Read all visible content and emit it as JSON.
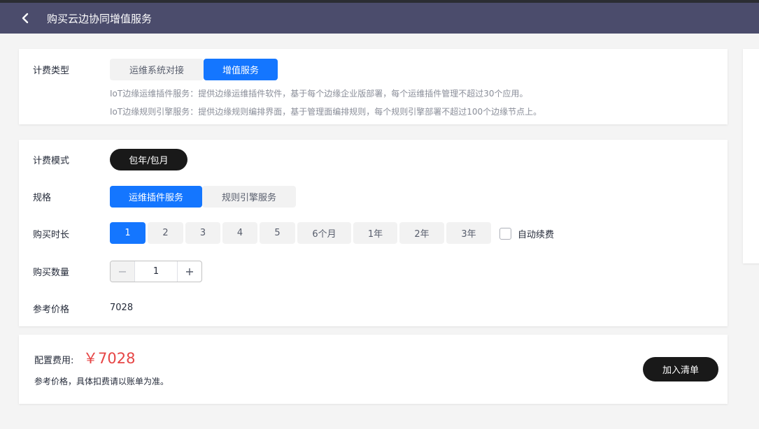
{
  "header": {
    "title": "购买云边协同增值服务",
    "back_icon": "chevron-left-icon"
  },
  "billing_type": {
    "label": "计费类型",
    "options": [
      "运维系统对接",
      "增值服务"
    ],
    "selected": "增值服务",
    "descriptions": [
      "IoT边缘运维插件服务：提供边缘运维插件软件，基于每个边缘企业版部署，每个运维插件管理不超过30个应用。",
      "IoT边缘规则引擎服务：提供边缘规则编排界面，基于管理面编排规则，每个规则引擎部署不超过100个边缘节点上。"
    ]
  },
  "billing_mode": {
    "label": "计费模式",
    "options": [
      "包年/包月"
    ],
    "selected": "包年/包月"
  },
  "spec": {
    "label": "规格",
    "options": [
      "运维插件服务",
      "规则引擎服务"
    ],
    "selected": "运维插件服务"
  },
  "duration": {
    "label": "购买时长",
    "options": [
      "1",
      "2",
      "3",
      "4",
      "5",
      "6个月",
      "1年",
      "2年",
      "3年"
    ],
    "selected": "1",
    "auto_renew_label": "自动续费",
    "auto_renew_checked": false
  },
  "quantity": {
    "label": "购买数量",
    "value": "1"
  },
  "ref_price": {
    "label": "参考价格",
    "value": "7028"
  },
  "footer": {
    "fee_label": "配置费用:",
    "fee_value": "￥7028",
    "note": "参考价格，具体扣费请以账单为准。",
    "add_button": "加入清单"
  },
  "colors": {
    "accent": "#1476ff",
    "header": "#4b4c6c",
    "price": "#e64545",
    "dark_button": "#191919"
  }
}
